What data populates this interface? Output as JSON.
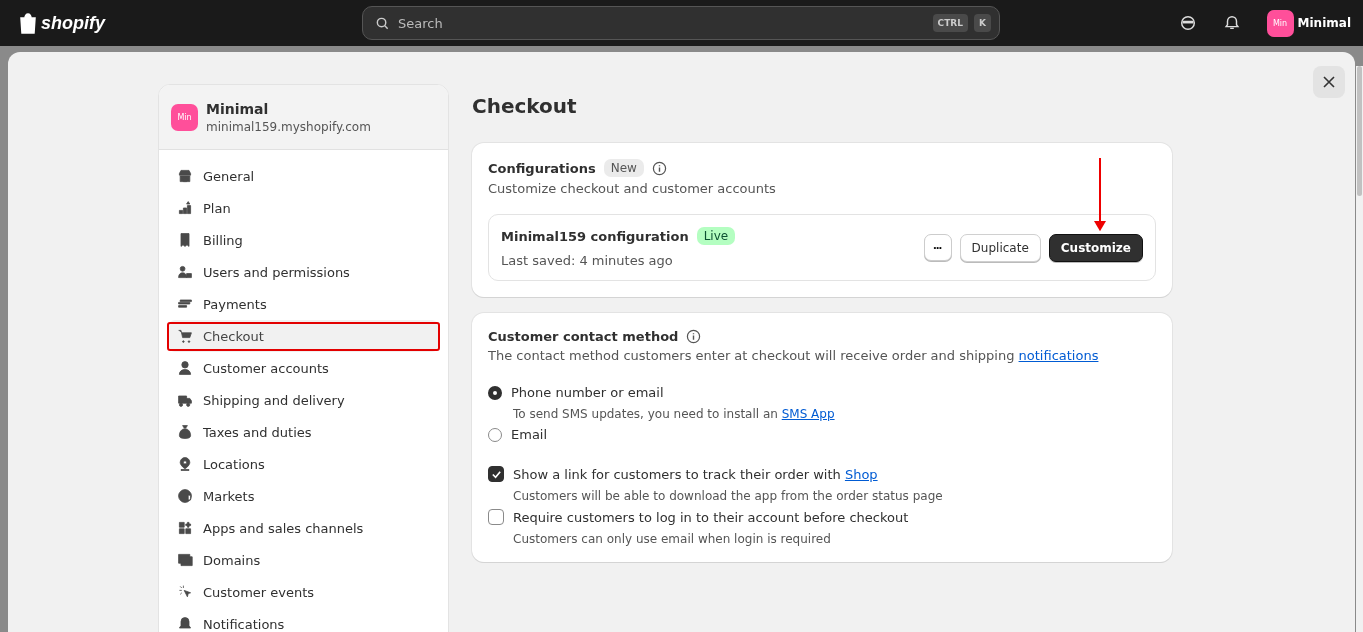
{
  "topbar": {
    "logo": "shopify",
    "search": {
      "placeholder": "Search",
      "keys": [
        "CTRL",
        "K"
      ]
    },
    "avatar": "Min",
    "store_name": "Minimal"
  },
  "store": {
    "avatar": "Min",
    "name": "Minimal",
    "domain": "minimal159.myshopify.com"
  },
  "sidebar": {
    "items": [
      {
        "label": "General",
        "selected": false
      },
      {
        "label": "Plan",
        "selected": false
      },
      {
        "label": "Billing",
        "selected": false
      },
      {
        "label": "Users and permissions",
        "selected": false
      },
      {
        "label": "Payments",
        "selected": false
      },
      {
        "label": "Checkout",
        "selected": true
      },
      {
        "label": "Customer accounts",
        "selected": false
      },
      {
        "label": "Shipping and delivery",
        "selected": false
      },
      {
        "label": "Taxes and duties",
        "selected": false
      },
      {
        "label": "Locations",
        "selected": false
      },
      {
        "label": "Markets",
        "selected": false
      },
      {
        "label": "Apps and sales channels",
        "selected": false
      },
      {
        "label": "Domains",
        "selected": false
      },
      {
        "label": "Customer events",
        "selected": false
      },
      {
        "label": "Notifications",
        "selected": false
      }
    ]
  },
  "page_title": "Checkout",
  "configurations": {
    "title": "Configurations",
    "badge": "New",
    "description": "Customize checkout and customer accounts",
    "config": {
      "name": "Minimal159 configuration",
      "status": "Live",
      "saved": "Last saved: 4 minutes ago",
      "more": "•••",
      "buttons": [
        "Duplicate",
        "Customize"
      ]
    }
  },
  "contact": {
    "title": "Customer contact method",
    "description": {
      "text": "The contact method customers enter at checkout will receive order and shipping ",
      "link": "notifications"
    },
    "options": [
      {
        "kind": "radio",
        "label": "Phone number or email",
        "selected": true,
        "help": {
          "text": "To send SMS updates, you need to install an ",
          "link": "SMS App"
        }
      },
      {
        "kind": "radio",
        "label": "Email",
        "selected": false
      },
      {
        "kind": "checkbox",
        "label": "Show a link for customers to track their order with ",
        "link": "Shop",
        "checked": true,
        "help": {
          "text": "Customers will be able to download the app from the order status page"
        }
      },
      {
        "kind": "checkbox",
        "label": "Require customers to log in to their account before checkout",
        "checked": false,
        "help": {
          "text": "Customers can only use email when login is required"
        }
      }
    ]
  }
}
